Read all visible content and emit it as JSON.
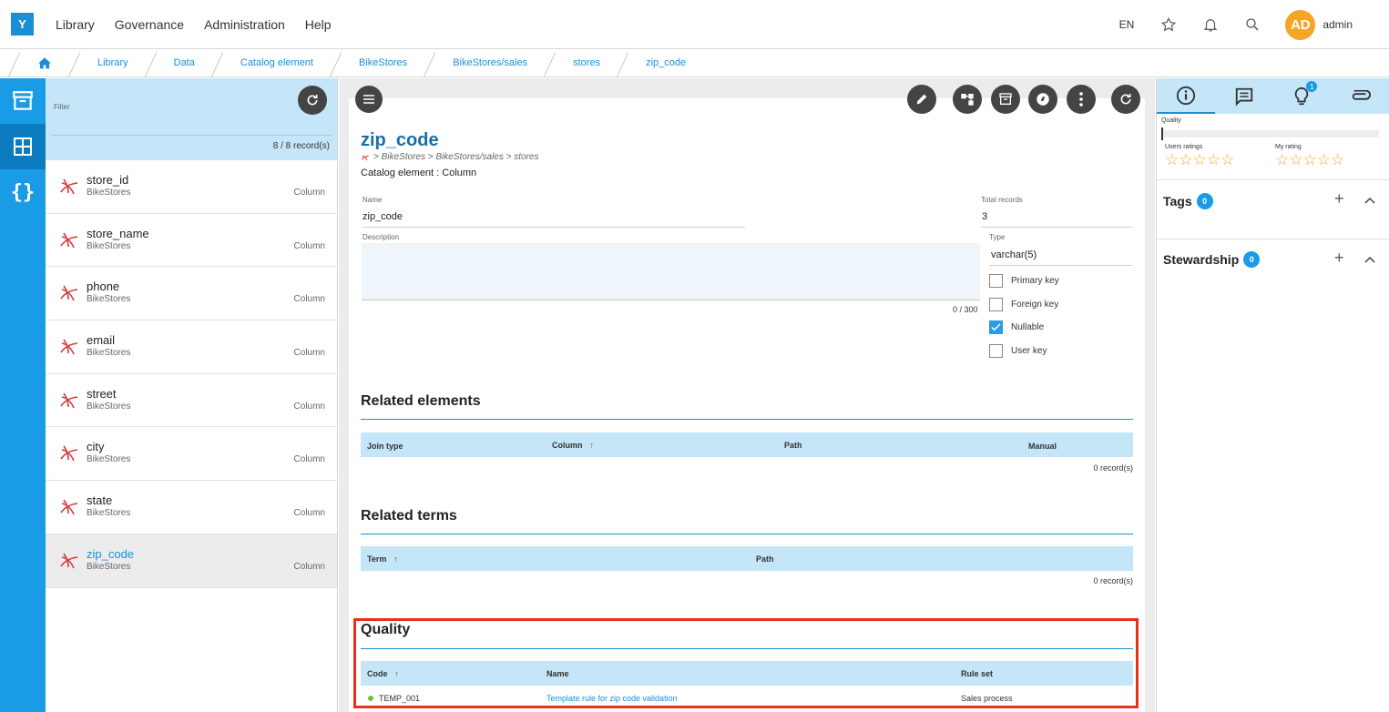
{
  "app": {
    "logo": "Y"
  },
  "topnav": [
    "Library",
    "Governance",
    "Administration",
    "Help"
  ],
  "topright": {
    "lang": "EN",
    "avatar": "AD",
    "user": "admin"
  },
  "breadcrumb": [
    "Library",
    "Data",
    "Catalog element",
    "BikeStores",
    "BikeStores/sales",
    "stores",
    "zip_code"
  ],
  "listpanel": {
    "filter_label": "Filter",
    "records": "8 / 8 record(s)",
    "items": [
      {
        "name": "store_id",
        "db": "BikeStores",
        "type": "Column"
      },
      {
        "name": "store_name",
        "db": "BikeStores",
        "type": "Column"
      },
      {
        "name": "phone",
        "db": "BikeStores",
        "type": "Column"
      },
      {
        "name": "email",
        "db": "BikeStores",
        "type": "Column"
      },
      {
        "name": "street",
        "db": "BikeStores",
        "type": "Column"
      },
      {
        "name": "city",
        "db": "BikeStores",
        "type": "Column"
      },
      {
        "name": "state",
        "db": "BikeStores",
        "type": "Column"
      },
      {
        "name": "zip_code",
        "db": "BikeStores",
        "type": "Column"
      }
    ]
  },
  "detail": {
    "title": "zip_code",
    "path": "> BikeStores > BikeStores/sales > stores",
    "subtitle": "Catalog element : Column",
    "name_label": "Name",
    "name_value": "zip_code",
    "total_label": "Total records",
    "total_value": "3",
    "desc_label": "Description",
    "counter": "0 / 300",
    "type_label": "Type",
    "type_value": "varchar(5)",
    "checkboxes": [
      {
        "label": "Primary key",
        "checked": false
      },
      {
        "label": "Foreign key",
        "checked": false
      },
      {
        "label": "Nullable",
        "checked": true
      },
      {
        "label": "User key",
        "checked": false
      }
    ]
  },
  "related_elements": {
    "title": "Related elements",
    "headers": [
      "Join type",
      "Column",
      "Path",
      "Manual"
    ],
    "records": "0 record(s)"
  },
  "related_terms": {
    "title": "Related terms",
    "headers": [
      "Term",
      "Path"
    ],
    "records": "0 record(s)"
  },
  "quality": {
    "title": "Quality",
    "headers": [
      "Code",
      "Name",
      "Rule set"
    ],
    "rows": [
      {
        "code": "TEMP_001",
        "name": "Template rule for zip code validation",
        "rule_set": "Sales process"
      }
    ]
  },
  "rightpanel": {
    "tab_badge": "1",
    "quality_label": "Quality",
    "users_ratings": "Users ratings",
    "my_rating": "My rating",
    "tags": {
      "label": "Tags",
      "count": "0"
    },
    "stewardship": {
      "label": "Stewardship",
      "count": "0"
    }
  }
}
